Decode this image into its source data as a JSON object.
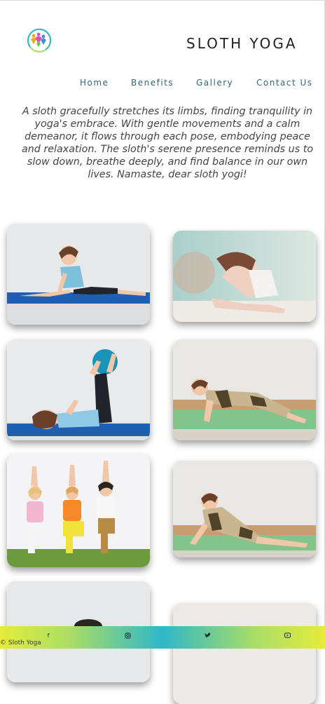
{
  "header": {
    "brand": "SLOTH YOGA",
    "logo_icon": "yoga-people-circle-logo"
  },
  "nav": {
    "items": [
      "Home",
      "Benefits",
      "Gallery",
      "Contact Us"
    ]
  },
  "intro": {
    "text": "A sloth gracefully stretches its limbs, finding tranquility in yoga's embrace. With gentle movements and a calm demeanor, it flows through each pose, embodying peace and relaxation. The sloth's serene presence reminds us to slow down, breathe deeply, and find balance in our own lives. Namaste, dear sloth yogi!"
  },
  "gallery": {
    "photos": [
      "girl-split-stretch-photo",
      "girl-backbend-photo",
      "girl-exercise-ball-photo",
      "boy-plank-pose-photo",
      "kids-tree-pose-photo",
      "boy-cobra-pose-photo",
      "child-yoga-photo-partial",
      "yoga-photo-partial"
    ]
  },
  "footer": {
    "icons": [
      "facebook-icon",
      "instagram-icon",
      "twitter-icon",
      "youtube-icon"
    ],
    "copyright": "© Sloth Yoga"
  },
  "colors": {
    "nav_text": "#33667a",
    "footer_gradient": [
      "#e6ec3a",
      "#a8dd68",
      "#2eb7c9"
    ]
  }
}
